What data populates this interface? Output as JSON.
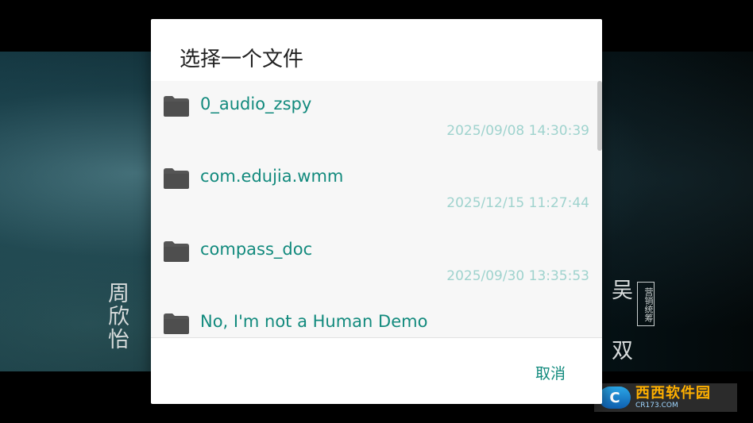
{
  "background": {
    "credit_left": "周欣怡",
    "credit_right_1": "吴",
    "credit_right_2": "双",
    "credit_box": "营销统筹",
    "watermark_logo": "C",
    "watermark_main": "西西软件园",
    "watermark_sub": "CR173.COM"
  },
  "dialog": {
    "title": "选择一个文件",
    "files": [
      {
        "name": "0_audio_zspy",
        "date": "2025/09/08 14:30:39",
        "icon": "folder-icon"
      },
      {
        "name": "com.edujia.wmm",
        "date": "2025/12/15 11:27:44",
        "icon": "folder-icon"
      },
      {
        "name": "compass_doc",
        "date": "2025/09/30 13:35:53",
        "icon": "folder-icon"
      },
      {
        "name": "No, I'm not a Human Demo",
        "date": "",
        "icon": "folder-icon"
      }
    ],
    "cancel_label": "取消"
  },
  "colors": {
    "accent": "#128a7d",
    "date": "#9fd3ce",
    "folder": "#555555"
  }
}
